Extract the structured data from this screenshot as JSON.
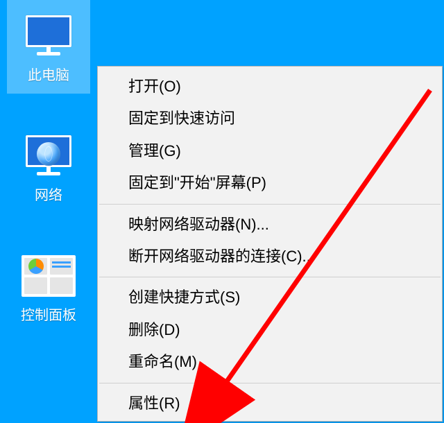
{
  "desktop": {
    "icons": [
      {
        "name": "this-pc",
        "label": "此电脑",
        "selected": true
      },
      {
        "name": "network",
        "label": "网络",
        "selected": false
      },
      {
        "name": "control-panel",
        "label": "控制面板",
        "selected": false
      }
    ]
  },
  "context_menu": {
    "target": "this-pc",
    "groups": [
      [
        {
          "id": "open",
          "label": "打开(O)"
        },
        {
          "id": "pin-quick",
          "label": "固定到快速访问"
        },
        {
          "id": "manage",
          "label": "管理(G)"
        },
        {
          "id": "pin-start",
          "label": "固定到\"开始\"屏幕(P)"
        }
      ],
      [
        {
          "id": "map-drive",
          "label": "映射网络驱动器(N)..."
        },
        {
          "id": "disc-drive",
          "label": "断开网络驱动器的连接(C)..."
        }
      ],
      [
        {
          "id": "shortcut",
          "label": "创建快捷方式(S)"
        },
        {
          "id": "delete",
          "label": "删除(D)"
        },
        {
          "id": "rename",
          "label": "重命名(M)"
        }
      ],
      [
        {
          "id": "properties",
          "label": "属性(R)"
        }
      ]
    ]
  },
  "annotation": {
    "type": "arrow",
    "color": "#ff0000",
    "points_to": "properties"
  }
}
